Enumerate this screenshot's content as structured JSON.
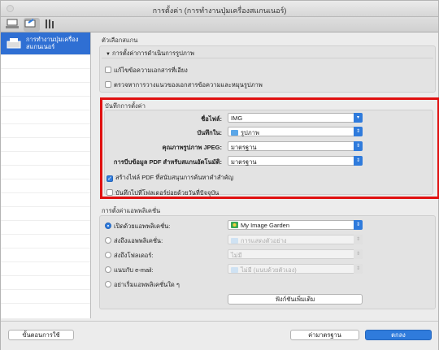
{
  "window": {
    "title": "การตั้งค่า (การทำงานปุ่มเครื่องสแกนเนอร์)"
  },
  "sidebar": {
    "items": [
      {
        "label": "การทำงานปุ่มเครื่องสแกนเนอร์"
      }
    ]
  },
  "scan_options": {
    "title": "ตัวเลือกสแกน",
    "image_process_title": "การตั้งค่าการดำเนินการรูปภาพ",
    "option1": "แก้ไขข้อความเอกสารที่เอียง",
    "option2": "ตรวจหาการวางแนวของเอกสารข้อความและหมุนรูปภาพ"
  },
  "save_settings": {
    "title": "บันทึกการตั้งค่า",
    "file_name_label": "ชื่อไฟล์:",
    "file_name_value": "IMG",
    "save_in_label": "บันทึกใน:",
    "save_in_value": "รูปภาพ",
    "jpeg_quality_label": "คุณภาพรูปภาพ JPEG:",
    "jpeg_quality_value": "มาตรฐาน",
    "pdf_compress_label": "การบีบข้อมูล PDF สำหรับสแกนอัตโนมัติ:",
    "pdf_compress_value": "มาตรฐาน",
    "searchable_pdf": "สร้างไฟล์ PDF ที่สนับสนุนการค้นหาคำสำคัญ",
    "save_subfolder": "บันทึกไปที่โฟลเดอร์ย่อยด้วยวันที่ปัจจุบัน"
  },
  "app_settings": {
    "title": "การตั้งค่าแอพพลิเคชั่น",
    "open_app_label": "เปิดด้วยแอพพลิเคชั่น:",
    "open_app_value": "My Image Garden",
    "send_app_label": "ส่งถึงแอพพลิเคชั่น:",
    "send_app_value": "การแสดงตัวอย่าง",
    "send_folder_label": "ส่งถึงโฟลเดอร์:",
    "send_folder_value": "ไม่มี",
    "email_label": "แนบกับ e-mail:",
    "email_value": "ไม่มี (แนบด้วยตัวเอง)",
    "no_start_label": "อย่าเริ่มแอพพลิเคชั่นใด ๆ",
    "more_functions_button": "ฟังก์ชันเพิ่มเติม"
  },
  "buttons": {
    "instructions": "ขั้นตอนการใช้",
    "defaults": "ค่ามาตรฐาน",
    "ok": "ตกลง"
  },
  "colors": {
    "accent": "#2f7bdc",
    "highlight": "#e01010",
    "sidebar_selected": "#2f6fd3"
  }
}
